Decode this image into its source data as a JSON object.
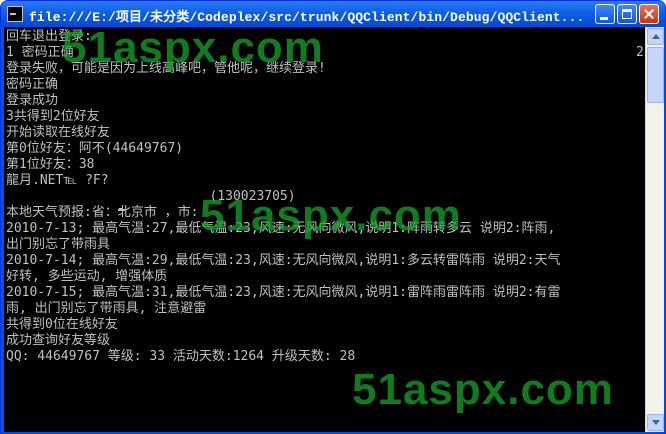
{
  "window": {
    "title": "file:///E:/项目/未分类/Codeplex/src/trunk/QQClient/bin/Debug/QQClient...",
    "icon": "console-icon"
  },
  "console": {
    "lines": [
      "回车退出登录:",
      "1 密码正确",
      "登录失败，可能是因为上线高峰吧，管他呢，继续登录!",
      "密码正确",
      "登录成功",
      "3共得到2位好友",
      "开始读取在线好友",
      "第0位好友：阿不(44649767)",
      "第1位好友：38",
      "龍月.NET℡ ?F?",
      "                          (130023705)",
      "本地天气预报:省：北京市 ，市:",
      "2010-7-13; 最高气温:27,最低气温:23,风速:无风向微风,说明1:阵雨转多云 说明2:阵雨,",
      "出门别忘了带雨具",
      "2010-7-14; 最高气温:29,最低气温:23,风速:无风向微风,说明1:多云转雷阵雨 说明2:天气",
      "好转, 多些运动, 增强体质",
      "2010-7-15; 最高气温:31,最低气温:23,风速:无风向微风,说明1:雷阵雨雷阵雨 说明2:有雷",
      "雨, 出门别忘了带雨具, 注意避雷",
      "共得到0位在线好友",
      "成功查询好友等级",
      "QQ: 44649767 等级: 33 活动天数:1264 升级天数: 28"
    ],
    "right_number": "2"
  },
  "watermarks": [
    "51aspx.com",
    "51aspx.com",
    "51aspx.com"
  ],
  "colors": {
    "console_bg": "#000000",
    "console_text": "#c0c0c0",
    "watermark": "#17a52a",
    "titlebar": "#0a5fe6"
  }
}
